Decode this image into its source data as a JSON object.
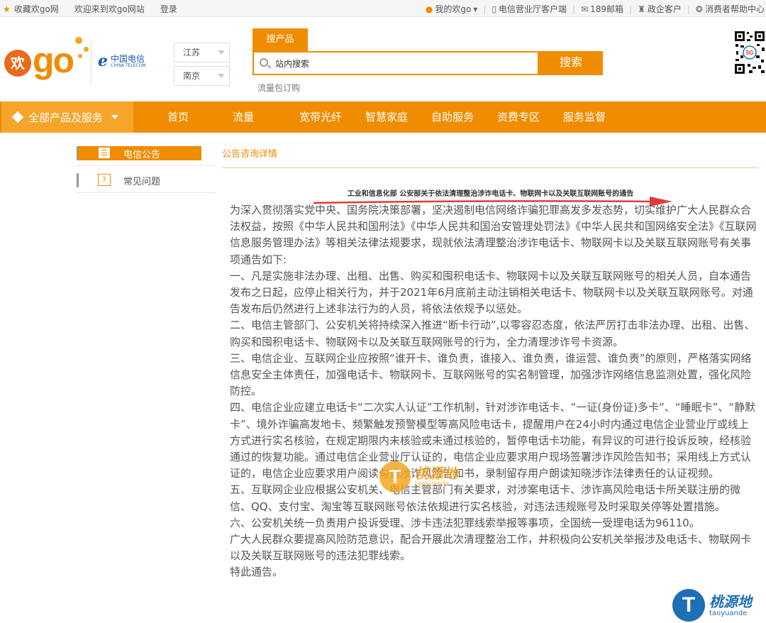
{
  "topbar": {
    "favorite": "收藏欢go网",
    "welcome": "欢迎来到欢go网站",
    "login": "登录",
    "my_go": "我的欢go",
    "client": "电信营业厅客户端",
    "mail": "189邮箱",
    "gov": "政企客户",
    "help": "消费者帮助中心"
  },
  "header": {
    "logo_huan": "欢",
    "logo_go": "go",
    "ct_cn": "中国电信",
    "ct_en": "CHINA TELECOM",
    "province": "江苏",
    "city": "南京",
    "search_tab": "搜产品",
    "search_value": "站内搜索",
    "search_button": "搜索",
    "hot_link": "流量包订购"
  },
  "nav": {
    "all": "全部产品及服务",
    "items": [
      "首页",
      "流量",
      "宽带光纤",
      "智慧家庭",
      "自助服务",
      "资费专区",
      "服务监督"
    ]
  },
  "sidebar": {
    "items": [
      {
        "label": "电信公告",
        "icon": "list-icon",
        "glyph": "☰"
      },
      {
        "label": "常见问题",
        "icon": "question-icon",
        "glyph": "?"
      }
    ]
  },
  "content": {
    "breadcrumb": "公告咨询详情",
    "title": "工业和信息化部 公安部关于依法清理整治涉诈电话卡、物联网卡以及关联互联网账号的通告",
    "paragraphs": [
      "为深入贯彻落实党中央、国务院决策部署，坚决遏制电信网络诈骗犯罪高发多发态势，切实维护广大人民群众合法权益，按照《中华人民共和国刑法》《中华人民共和国治安管理处罚法》《中华人民共和国网络安全法》《互联网信息服务管理办法》等相关法律法规要求，现就依法清理整治涉诈电话卡、物联网卡以及关联互联网账号有关事项通告如下:",
      "一、凡是实施非法办理、出租、出售、购买和囤积电话卡、物联网卡以及关联互联网账号的相关人员，自本通告发布之日起，应停止相关行为，并于2021年6月底前主动注销相关电话卡、物联网卡以及关联互联网账号。对通告发布后仍然进行上述非法行为的人员，将依法依规予以惩处。",
      "二、电信主管部门、公安机关将持续深入推进“断卡行动”,以零容忍态度，依法严厉打击非法办理、出租、出售、购买和囤积电话卡、物联网卡以及关联互联网账号的行为，全力清理涉诈号卡资源。",
      "三、电信企业、互联网企业应按照“谁开卡、谁负责，谁接入、谁负责，谁运营、谁负责”的原则，严格落实网络信息安全主体责任，加强电话卡、物联网卡、互联网账号的实名制管理，加强涉诈网络信息监测处置，强化风险防控。",
      "四、电信企业应建立电话卡“二次实人认证”工作机制，针对涉诈电话卡、“一证(身份证)多卡”、“睡眠卡”、“静默卡”、境外诈骗高发地卡、频繁触发预警模型等高风险电话卡，提醒用户在24小时内通过电信企业营业厅或线上方式进行实名核验，在规定期限内未核验或未通过核验的，暂停电话卡功能，有异议的可进行投诉反映，经核验通过的恢复功能。通过电信企业营业厅认证的，电信企业应要求用户现场签署涉诈风险告知书；采用线上方式认证的，电信企业应要求用户阅读勾选涉诈风险告知书，录制留存用户朗读知晓涉诈法律责任的认证视频。",
      "五、互联网企业应根据公安机关、电信主管部门有关要求，对涉案电话卡、涉诈高风险电话卡所关联注册的微信、QQ、支付宝、淘宝等互联网账号依法依规进行实名核验，对违法违规账号及时采取关停等处置措施。",
      "六、公安机关统一负责用户投诉受理、涉卡违法犯罪线索举报等事项，全国统一受理电话为96110。",
      "广大人民群众要提高风险防范意识，配合开展此次清理整治工作，并积极向公安机关举报涉及电话卡、物联网卡以及关联互联网账号的违法犯罪线索。",
      "特此通告。"
    ]
  },
  "watermark": {
    "letter": "T",
    "cn": "桃源地",
    "en": "taoyuande"
  },
  "colors": {
    "brand": "#f08c00",
    "nav_all": "#f5a52a",
    "arrow": "#e23b3b",
    "watermark_orange": "#f5a623",
    "watermark_blue": "#1e6fb5"
  }
}
